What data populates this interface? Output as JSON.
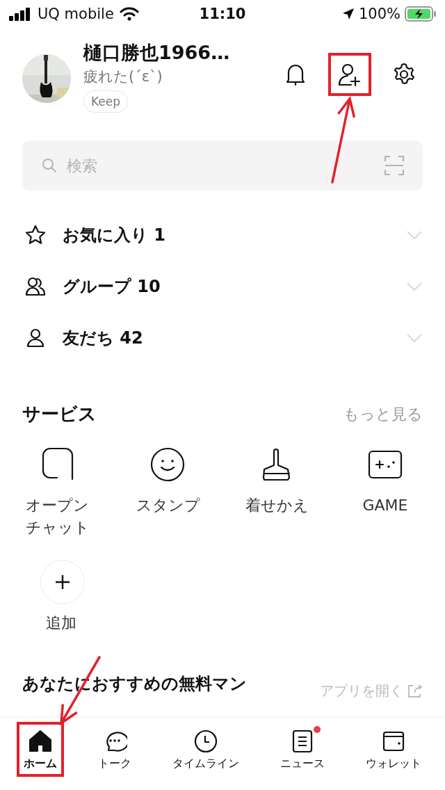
{
  "status_bar": {
    "carrier": "UQ mobile",
    "time": "11:10",
    "battery": "100%"
  },
  "profile": {
    "name": "樋口勝也1966…",
    "status": "疲れた(´ε`)",
    "chip": "Keep"
  },
  "header_actions": [
    {
      "kind": "bell",
      "highlighted": false
    },
    {
      "kind": "add-friend",
      "highlighted": true
    },
    {
      "kind": "settings",
      "highlighted": false
    }
  ],
  "search": {
    "placeholder": "検索"
  },
  "sections": [
    {
      "kind": "star",
      "label": "お気に入り 1"
    },
    {
      "kind": "group",
      "label": "グループ 10"
    },
    {
      "kind": "friend",
      "label": "友だち 42"
    }
  ],
  "services": {
    "title": "サービス",
    "more": "もっと見る",
    "items": [
      {
        "kind": "openchat",
        "label": "オープンチャット"
      },
      {
        "kind": "sticker",
        "label": "スタンプ"
      },
      {
        "kind": "theme",
        "label": "着せかえ"
      },
      {
        "kind": "game",
        "label": "GAME"
      }
    ],
    "add": {
      "label": "追加"
    }
  },
  "recommend": {
    "title": "あなたにおすすめの無料マン",
    "link": "アプリを開く"
  },
  "tabs": [
    {
      "kind": "home",
      "label": "ホーム",
      "selected": true,
      "badge": false,
      "highlighted": true
    },
    {
      "kind": "talk",
      "label": "トーク",
      "selected": false,
      "badge": false,
      "highlighted": false
    },
    {
      "kind": "timeline",
      "label": "タイムライン",
      "selected": false,
      "badge": false,
      "highlighted": false
    },
    {
      "kind": "news",
      "label": "ニュース",
      "selected": false,
      "badge": true,
      "highlighted": false
    },
    {
      "kind": "wallet",
      "label": "ウォレット",
      "selected": false,
      "badge": false,
      "highlighted": false
    }
  ]
}
